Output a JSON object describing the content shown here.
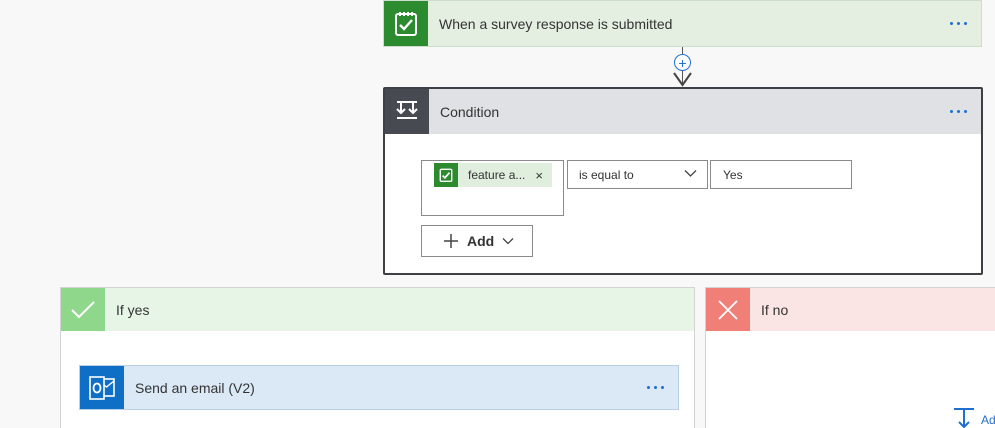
{
  "trigger": {
    "title": "When a survey response is submitted",
    "icon": "survey-icon",
    "color": "#2c8a2f"
  },
  "connector": {
    "insert_icon": "plus-icon"
  },
  "condition": {
    "title": "Condition",
    "icon": "condition-icon",
    "token_label": "feature a...",
    "token_remove": "×",
    "operator": "is equal to",
    "value": "Yes",
    "add_label": "Add"
  },
  "branches": {
    "yes": {
      "title": "If yes",
      "color": "#8fd88b",
      "action": {
        "title": "Send an email (V2)",
        "icon": "outlook-icon",
        "color": "#0f6fc6"
      }
    },
    "no": {
      "title": "If no",
      "color": "#f07f78",
      "add_action_label": "Ad"
    }
  }
}
